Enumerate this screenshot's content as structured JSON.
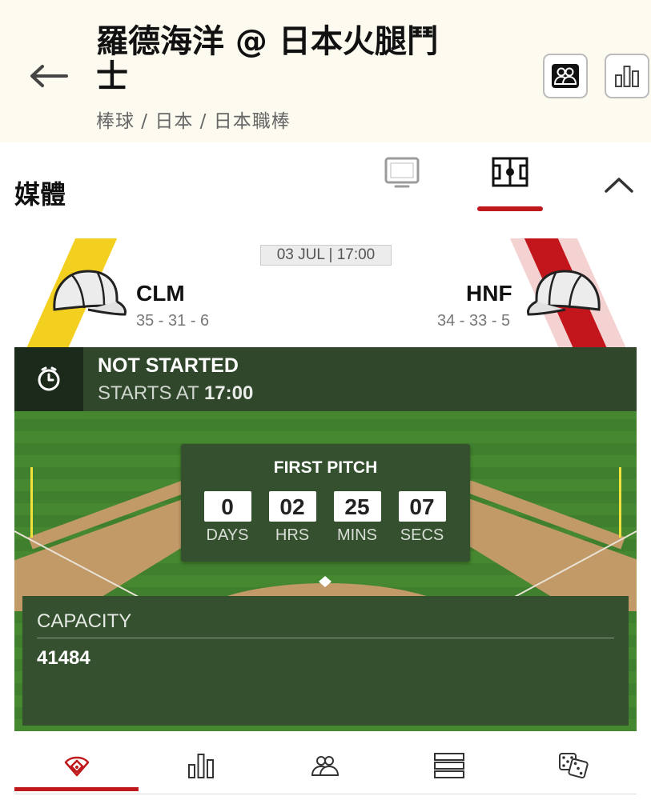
{
  "header": {
    "title": "羅德海洋 @ 日本火腿鬥士",
    "breadcrumb": "棒球 / 日本 / 日本職棒"
  },
  "media": {
    "label": "媒體"
  },
  "match": {
    "date": "03 JUL | 17:00",
    "home": {
      "abbr": "CLM",
      "record": "35 - 31 - 6",
      "color": "#f3cf1f"
    },
    "away": {
      "abbr": "HNF",
      "record": "34 - 33 - 5",
      "color": "#c3161c"
    }
  },
  "status": {
    "title": "NOT STARTED",
    "starts_prefix": "STARTS AT",
    "starts_time": "17:00"
  },
  "countdown": {
    "title": "FIRST PITCH",
    "cells": [
      {
        "value": "0",
        "label": "DAYS"
      },
      {
        "value": "02",
        "label": "HRS"
      },
      {
        "value": "25",
        "label": "MINS"
      },
      {
        "value": "07",
        "label": "SECS"
      }
    ]
  },
  "venue": {
    "capacity_label": "CAPACITY",
    "capacity_value": "41484"
  },
  "colors": {
    "accent": "#c0191d",
    "field_green": "#3e7d2c",
    "panel_green": "#34502f"
  }
}
